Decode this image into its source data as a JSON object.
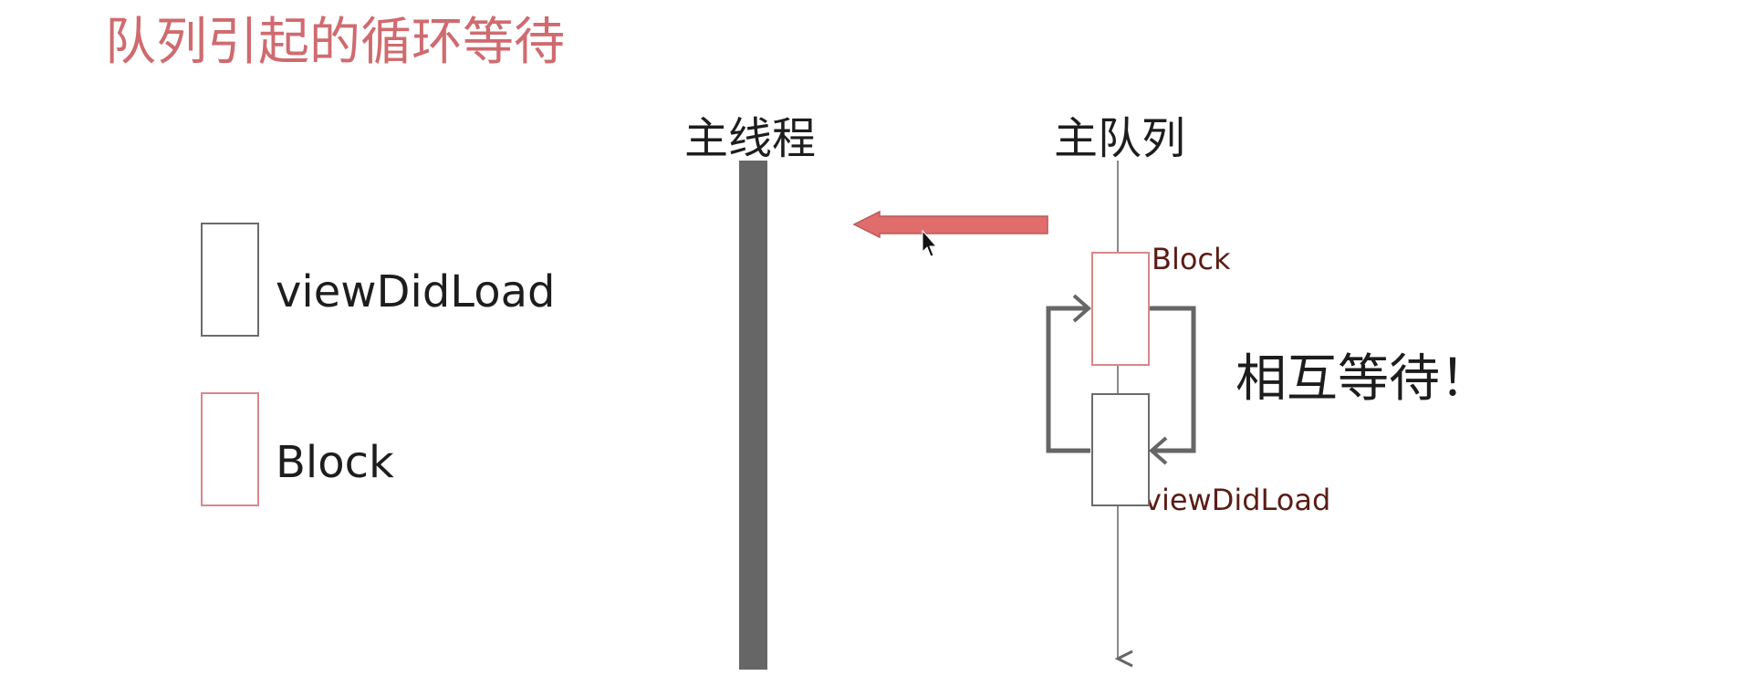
{
  "title": "队列引起的循环等待",
  "columns": {
    "main_thread": "主线程",
    "main_queue": "主队列"
  },
  "legend": {
    "viewdidload": "viewDidLoad",
    "block": "Block"
  },
  "queue_items": {
    "block": "Block",
    "viewdidload": "viewDidLoad"
  },
  "warning": "相互等待！",
  "colors": {
    "title": "#cf6b6f",
    "arrow_fill": "#e06d6c",
    "block_border": "#d9878a",
    "gray_border": "#6b6b6b",
    "thread_bar": "#666666",
    "cycle_arrow": "#666666",
    "queue_line": "#8a8a8a",
    "small_label": "#5a1d15"
  }
}
